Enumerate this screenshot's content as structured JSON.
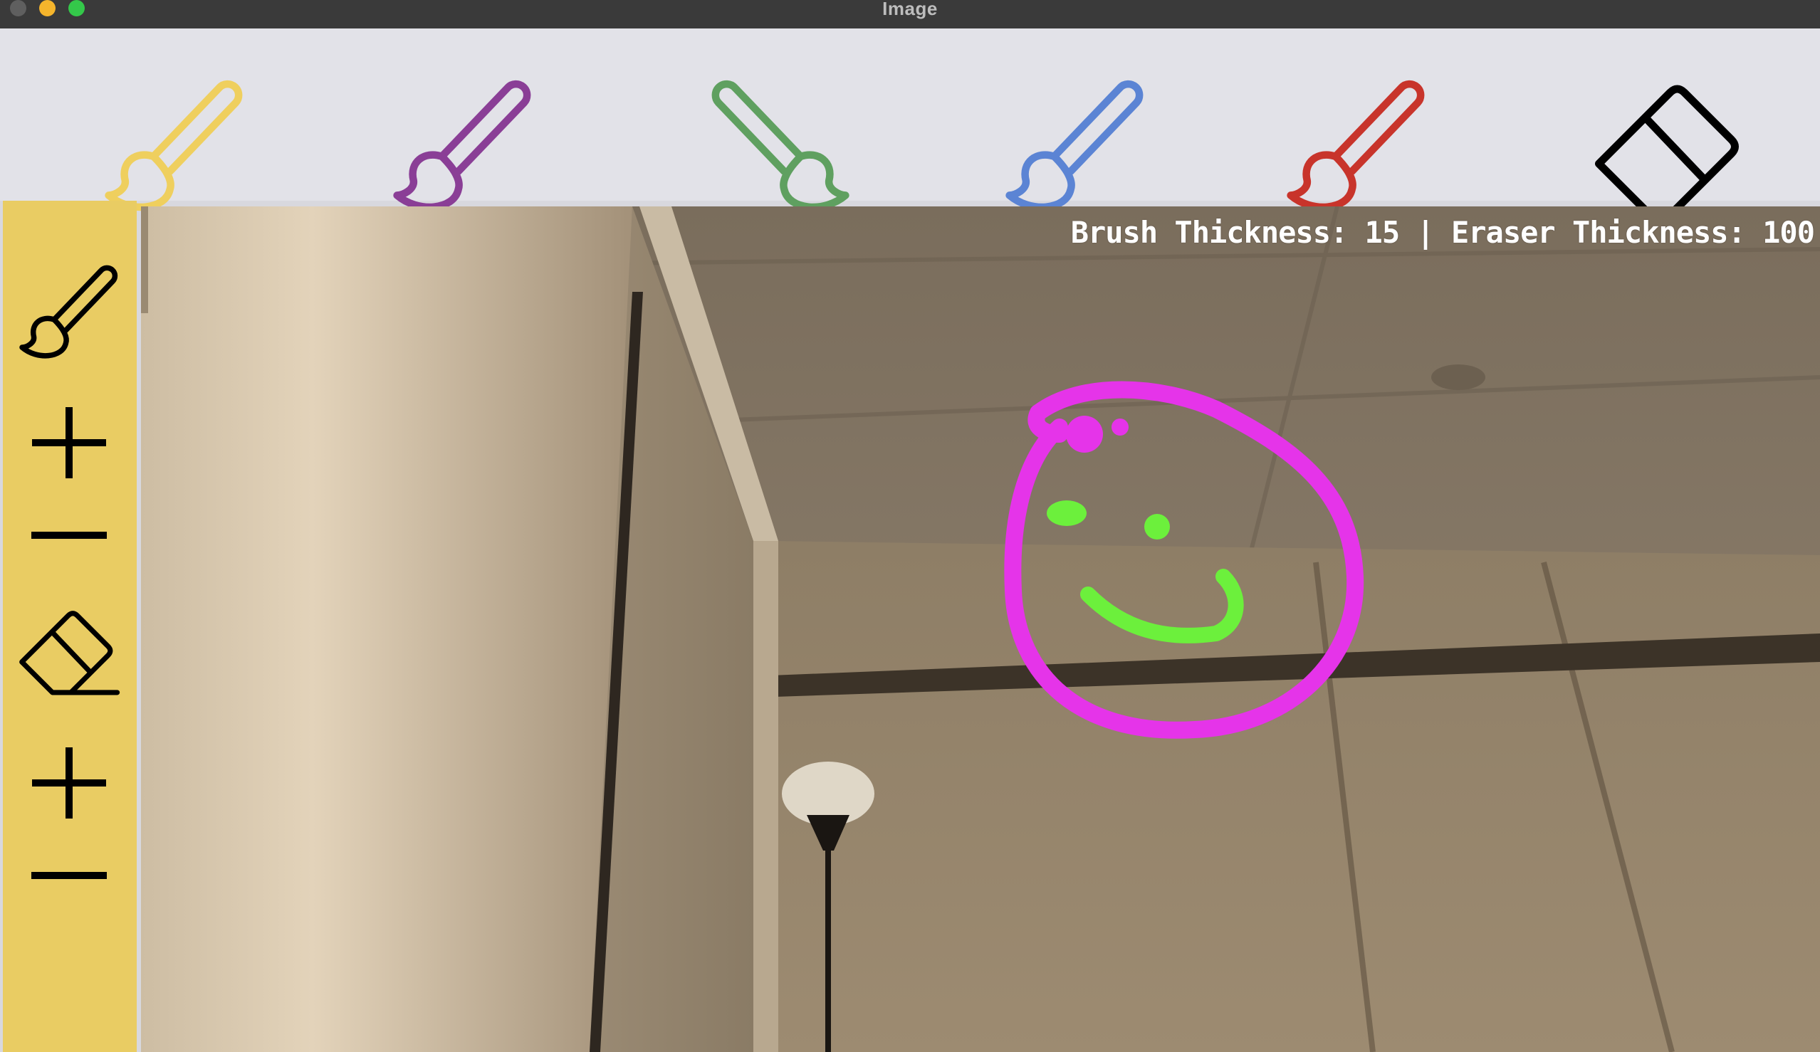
{
  "window": {
    "title": "Image"
  },
  "toolbar": {
    "brushes": [
      {
        "name": "yellow-brush",
        "color": "#efcf5e"
      },
      {
        "name": "purple-brush",
        "color": "#8a3e96"
      },
      {
        "name": "green-brush",
        "color": "#5fa060"
      },
      {
        "name": "blue-brush",
        "color": "#5b84d4"
      },
      {
        "name": "red-brush",
        "color": "#c8342b"
      }
    ],
    "eraser": {
      "icon": "eraser-icon",
      "color": "#000000"
    }
  },
  "sidebar": {
    "background": "#e9cc63",
    "items": [
      {
        "icon": "brush-icon"
      },
      {
        "icon": "plus-icon",
        "action": "increase-brush-thickness"
      },
      {
        "icon": "minus-icon",
        "action": "decrease-brush-thickness"
      },
      {
        "icon": "eraser-icon"
      },
      {
        "icon": "plus-icon",
        "action": "increase-eraser-thickness"
      },
      {
        "icon": "minus-icon",
        "action": "decrease-eraser-thickness"
      }
    ]
  },
  "canvas": {
    "status": "Brush Thickness: 15 | Eraser Thickness: 100",
    "brush_thickness": 15,
    "eraser_thickness": 100,
    "drawing": {
      "outline_color": "#e534e9",
      "face_color": "#6cf03c"
    }
  }
}
